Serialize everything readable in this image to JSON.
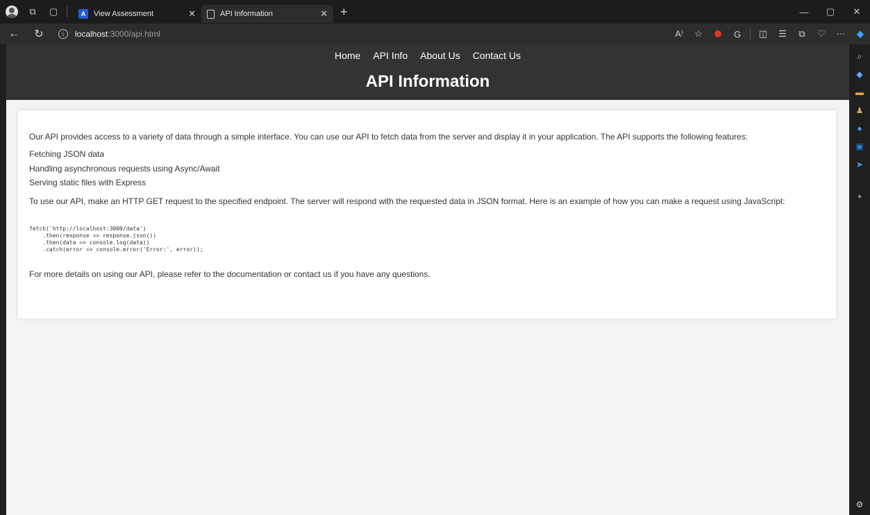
{
  "browser": {
    "tabs": [
      {
        "label": "View Assessment",
        "favicon": "A"
      },
      {
        "label": "API Information"
      }
    ],
    "address": {
      "host": "localhost",
      "path": ":3000/api.html"
    }
  },
  "site": {
    "nav": [
      "Home",
      "API Info",
      "About Us",
      "Contact Us"
    ],
    "title": "API Information"
  },
  "content": {
    "intro": "Our API provides access to a variety of data through a simple interface. You can use our API to fetch data from the server and display it in your application. The API supports the following features:",
    "features": [
      "Fetching JSON data",
      "Handling asynchronous requests using Async/Await",
      "Serving static files with Express"
    ],
    "usage": "To use our API, make an HTTP GET request to the specified endpoint. The server will respond with the requested data in JSON format. Here is an example of how you can make a request using JavaScript:",
    "code": "fetch('http://localhost:3000/data')\n    .then(response => response.json())\n    .then(data => console.log(data))\n    .catch(error => console.error('Error:', error));",
    "footer_text": "For more details on using our API, please refer to the documentation or contact us if you have any questions."
  },
  "colors": {
    "header_bg": "#333333",
    "page_bg": "#f4f4f4",
    "card_bg": "#ffffff",
    "text": "#333333"
  }
}
